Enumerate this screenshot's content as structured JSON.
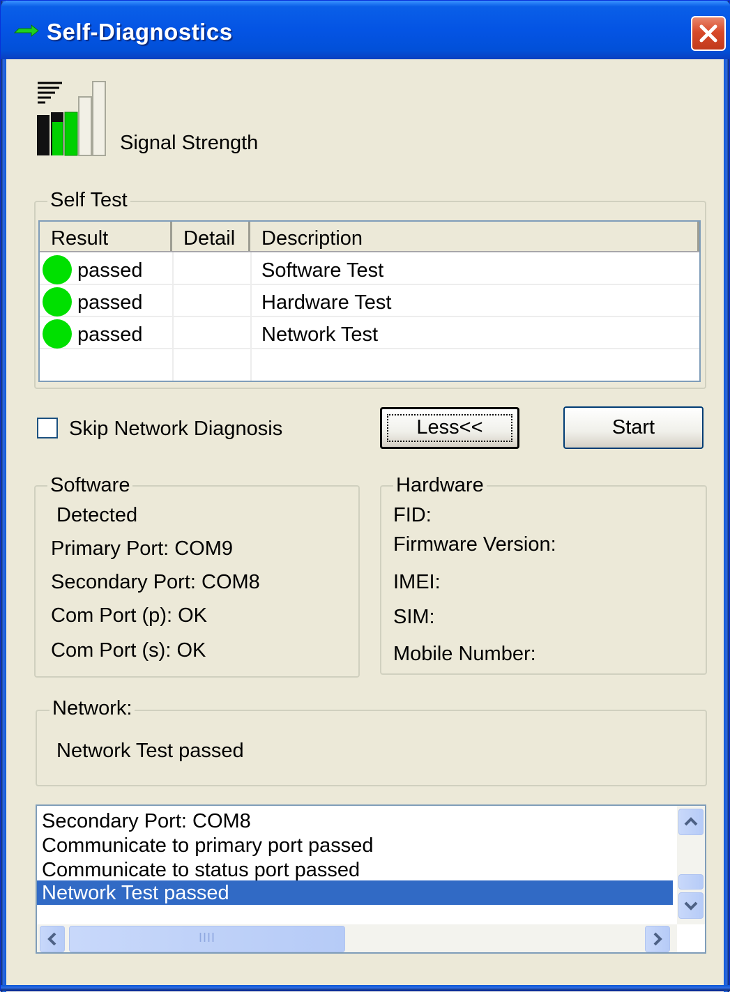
{
  "window": {
    "title": "Self-Diagnostics"
  },
  "signal": {
    "label": "Signal Strength",
    "bars_lit": 2,
    "bars_total": 4,
    "color_active": "#00D000"
  },
  "self_test": {
    "group_label": "Self Test",
    "columns": [
      "Result",
      "Detail",
      "Description"
    ],
    "rows": [
      {
        "result": "passed",
        "detail": "",
        "description": "Software Test"
      },
      {
        "result": "passed",
        "detail": "",
        "description": "Hardware Test"
      },
      {
        "result": "passed",
        "detail": "",
        "description": "Network Test"
      }
    ],
    "status_color": "#00E000"
  },
  "options": {
    "skip_network_label": "Skip Network Diagnosis",
    "skip_network_checked": false
  },
  "buttons": {
    "less_label": "Less<<",
    "start_label": "Start"
  },
  "software": {
    "group_label": "Software",
    "detected": "Detected",
    "primary_port": "Primary Port: COM9",
    "secondary_port": "Secondary Port: COM8",
    "com_port_p": "Com Port (p): OK",
    "com_port_s": "Com Port (s): OK"
  },
  "hardware": {
    "group_label": "Hardware",
    "fid": "FID:",
    "firmware": "Firmware Version:",
    "imei": "IMEI:",
    "sim": "SIM:",
    "mobile": "Mobile Number:"
  },
  "network": {
    "group_label": "Network:",
    "status": "Network Test passed"
  },
  "log": {
    "lines": [
      "Secondary Port: COM8",
      "Communicate to primary port passed",
      "Communicate to status port passed",
      "Network Test passed"
    ],
    "selected_index": 3,
    "hscroll_grip": "IIII"
  },
  "colors": {
    "title_bar": "#0454E4",
    "dialog_bg": "#ECE9D8",
    "selection": "#316AC5",
    "close": "#D84A2A"
  }
}
